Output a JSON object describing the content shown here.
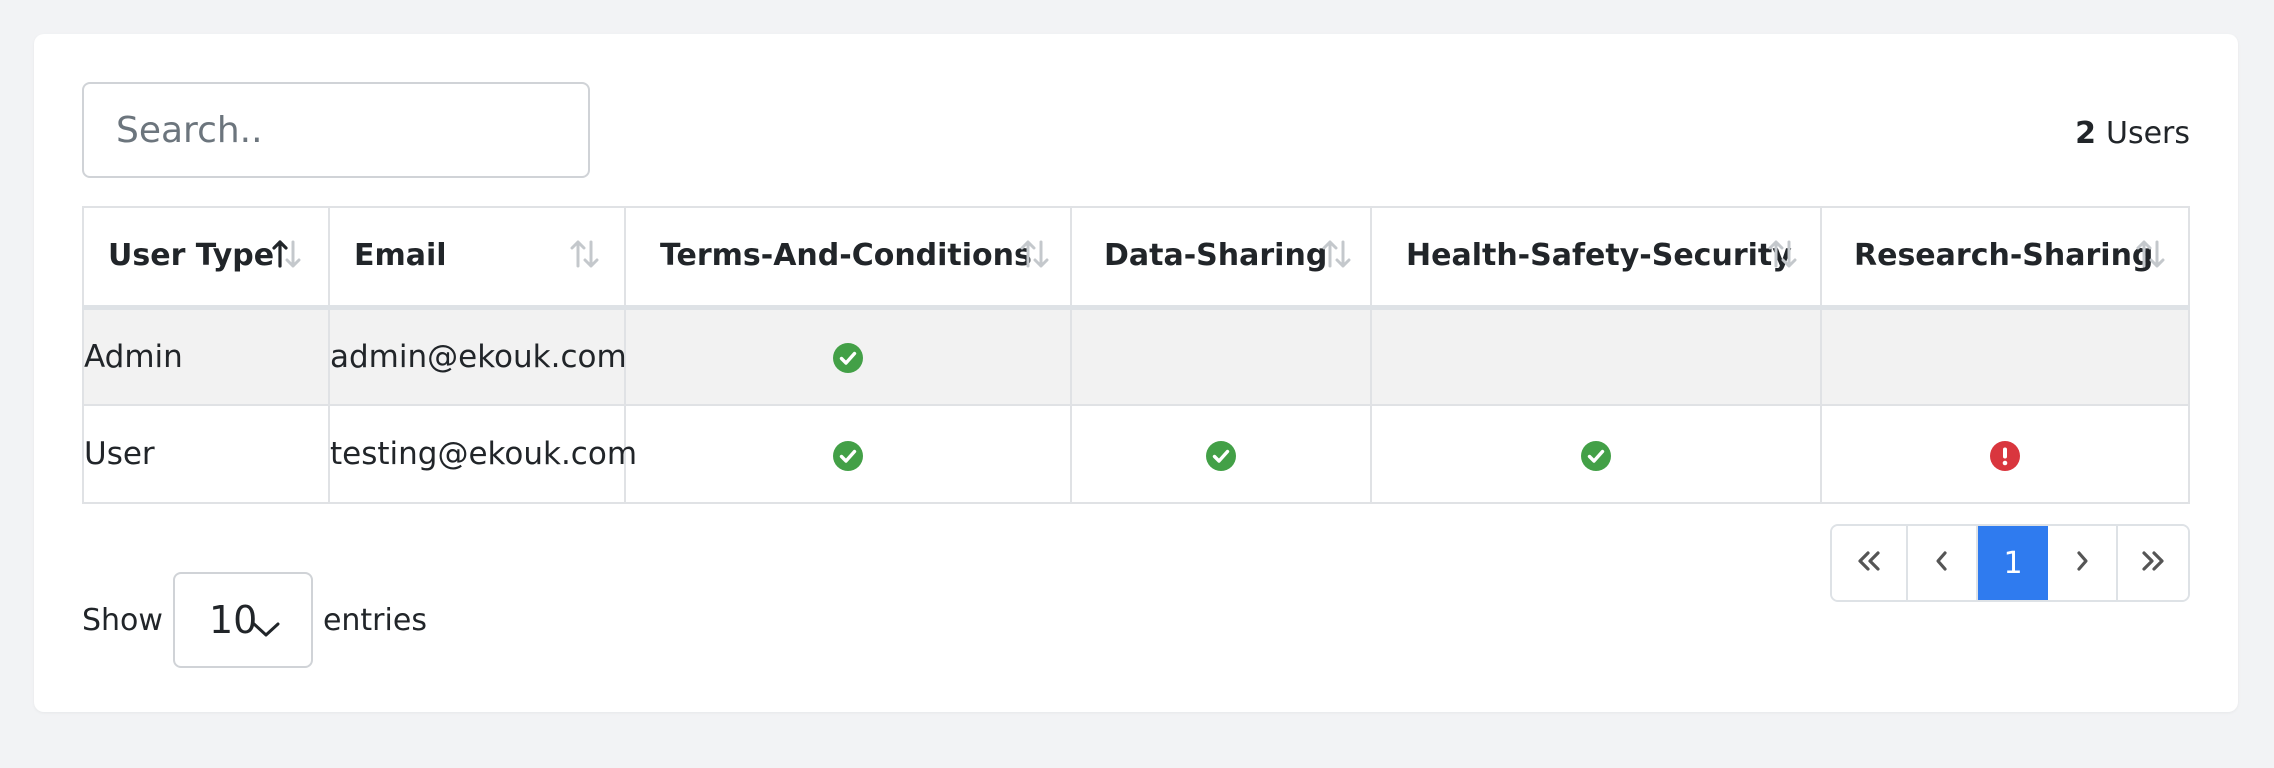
{
  "search": {
    "placeholder": "Search.."
  },
  "summary": {
    "count": "2",
    "label": "Users"
  },
  "table": {
    "columns": [
      {
        "label": "User Type",
        "sort": "asc"
      },
      {
        "label": "Email",
        "sort": "none"
      },
      {
        "label": "Terms-And-Conditions",
        "sort": "none"
      },
      {
        "label": "Data-Sharing",
        "sort": "none"
      },
      {
        "label": "Health-Safety-Security",
        "sort": "none"
      },
      {
        "label": "Research-Sharing",
        "sort": "none"
      }
    ],
    "rows": [
      {
        "user_type": "Admin",
        "email": "admin@ekouk.com",
        "terms_and_conditions": "check-circle-icon",
        "data_sharing": "",
        "health_safety_security": "",
        "research_sharing": ""
      },
      {
        "user_type": "User",
        "email": "testing@ekouk.com",
        "terms_and_conditions": "check-circle-icon",
        "data_sharing": "check-circle-icon",
        "health_safety_security": "check-circle-icon",
        "research_sharing": "exclamation-circle-icon"
      }
    ]
  },
  "footer": {
    "show_label": "Show",
    "entries_value": "10",
    "entries_label": "entries"
  },
  "pagination": {
    "current_page": "1"
  },
  "colors": {
    "accent": "#2f7bef",
    "success": "#43a047",
    "danger": "#d9363e",
    "page_bg": "#f2f3f5"
  }
}
